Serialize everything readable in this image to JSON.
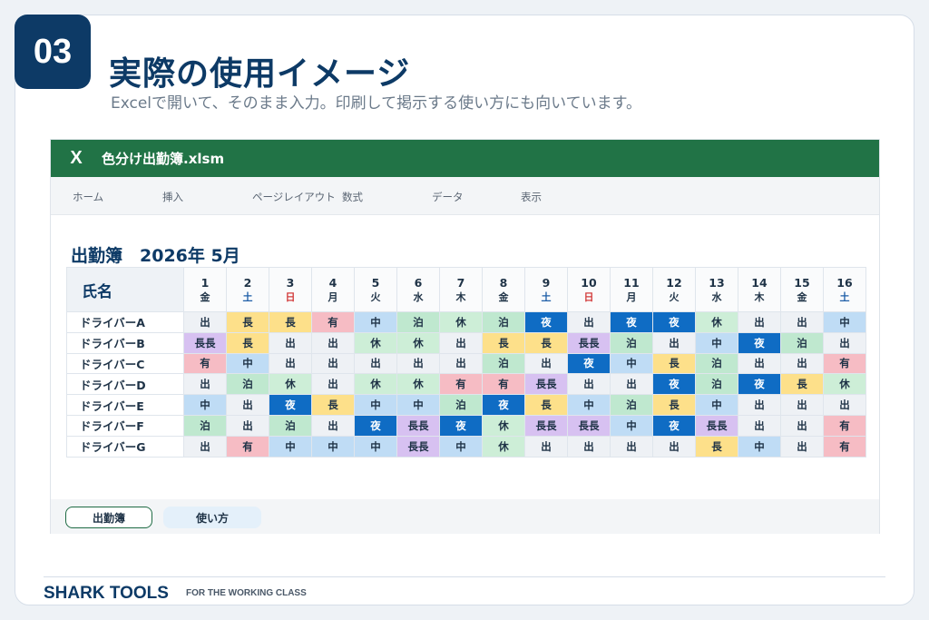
{
  "slide": {
    "number": "03",
    "title": "実際の使用イメージ",
    "subtitle": "Excelで開いて、そのまま入力。印刷して掲示する使い方にも向いています。"
  },
  "excel": {
    "logo": "X",
    "filename": "色分け出勤簿.xlsm",
    "ribbon": [
      "ホーム",
      "挿入",
      "ページレイアウト",
      "数式",
      "データ",
      "表示"
    ],
    "sheet_title": "出勤簿　2026年 5月",
    "name_header": "氏名",
    "days": [
      {
        "d": "1",
        "w": "金"
      },
      {
        "d": "2",
        "w": "土"
      },
      {
        "d": "3",
        "w": "日"
      },
      {
        "d": "4",
        "w": "月"
      },
      {
        "d": "5",
        "w": "火"
      },
      {
        "d": "6",
        "w": "水"
      },
      {
        "d": "7",
        "w": "木"
      },
      {
        "d": "8",
        "w": "金"
      },
      {
        "d": "9",
        "w": "土"
      },
      {
        "d": "10",
        "w": "日"
      },
      {
        "d": "11",
        "w": "月"
      },
      {
        "d": "12",
        "w": "火"
      },
      {
        "d": "13",
        "w": "水"
      },
      {
        "d": "14",
        "w": "木"
      },
      {
        "d": "15",
        "w": "金"
      },
      {
        "d": "16",
        "w": "土"
      }
    ],
    "rows": [
      {
        "name": "ドライバーA",
        "cells": [
          "出",
          "長",
          "長",
          "有",
          "中",
          "泊",
          "休",
          "泊",
          "夜",
          "出",
          "夜",
          "夜",
          "休",
          "出",
          "出",
          "中"
        ]
      },
      {
        "name": "ドライバーB",
        "cells": [
          "長長",
          "長",
          "出",
          "出",
          "休",
          "休",
          "出",
          "長",
          "長",
          "長長",
          "泊",
          "出",
          "中",
          "夜",
          "泊",
          "出"
        ]
      },
      {
        "name": "ドライバーC",
        "cells": [
          "有",
          "中",
          "出",
          "出",
          "出",
          "出",
          "出",
          "泊",
          "出",
          "夜",
          "中",
          "長",
          "泊",
          "出",
          "出",
          "有"
        ]
      },
      {
        "name": "ドライバーD",
        "cells": [
          "出",
          "泊",
          "休",
          "出",
          "休",
          "休",
          "有",
          "有",
          "長長",
          "出",
          "出",
          "夜",
          "泊",
          "夜",
          "長",
          "休"
        ]
      },
      {
        "name": "ドライバーE",
        "cells": [
          "中",
          "出",
          "夜",
          "長",
          "中",
          "中",
          "泊",
          "夜",
          "長",
          "中",
          "泊",
          "長",
          "中",
          "出",
          "出",
          "出"
        ]
      },
      {
        "name": "ドライバーF",
        "cells": [
          "泊",
          "出",
          "泊",
          "出",
          "夜",
          "長長",
          "夜",
          "休",
          "長長",
          "長長",
          "中",
          "夜",
          "長長",
          "出",
          "出",
          "有"
        ]
      },
      {
        "name": "ドライバーG",
        "cells": [
          "出",
          "有",
          "中",
          "中",
          "中",
          "長長",
          "中",
          "休",
          "出",
          "出",
          "出",
          "出",
          "長",
          "中",
          "出",
          "有"
        ]
      }
    ],
    "tabs": [
      "出勤簿",
      "使い方"
    ]
  },
  "footer": {
    "brand": "SHARK TOOLS",
    "tagline": "FOR THE WORKING CLASS"
  },
  "colors": {
    "excel_green": "#217346",
    "navy": "#0d3a66",
    "night": "#0f6cc4"
  }
}
